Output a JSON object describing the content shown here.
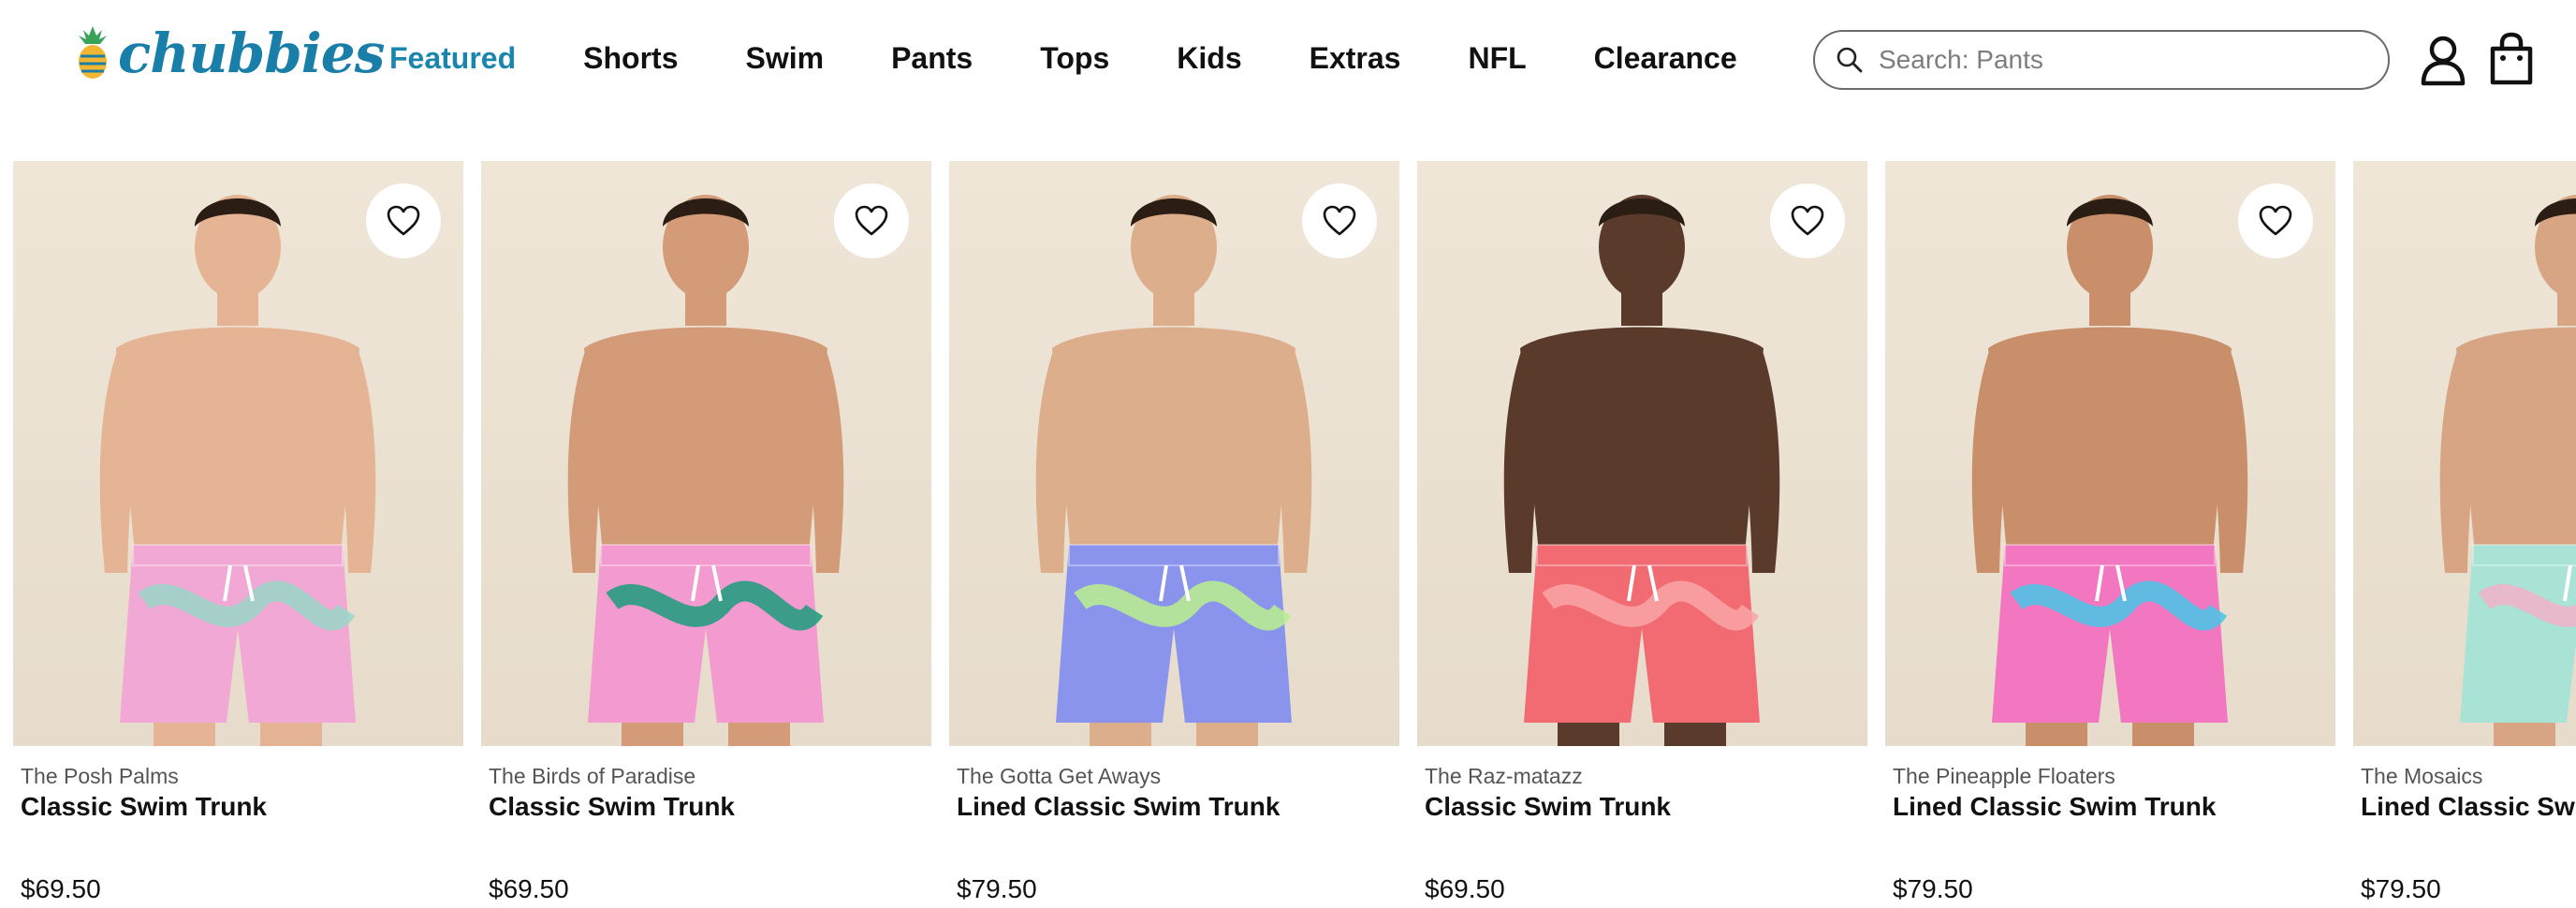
{
  "brand": {
    "name": "chubbies",
    "logo_icon": "pineapple-icon",
    "color": "#1a7fa8"
  },
  "nav": {
    "items": [
      {
        "label": "Featured",
        "active": true
      },
      {
        "label": "Shorts"
      },
      {
        "label": "Swim"
      },
      {
        "label": "Pants"
      },
      {
        "label": "Tops"
      },
      {
        "label": "Kids"
      },
      {
        "label": "Extras"
      },
      {
        "label": "NFL"
      },
      {
        "label": "Clearance"
      }
    ],
    "active_color": "#1a86ad"
  },
  "search": {
    "placeholder": "Search: Pants",
    "value": "",
    "icon": "search-icon"
  },
  "header_icons": {
    "account": "user-icon",
    "cart": "shopping-bag-icon"
  },
  "products": [
    {
      "name": "The Posh Palms",
      "title": "Classic Swim Trunk",
      "price": "$69.50",
      "wishlist_icon": "heart-icon",
      "skin": "#e4b494",
      "shorts": "#f2a8d4",
      "accent": "#9ad6c8"
    },
    {
      "name": "The Birds of Paradise",
      "title": "Classic Swim Trunk",
      "price": "$69.50",
      "wishlist_icon": "heart-icon",
      "skin": "#d39b78",
      "shorts": "#f39bd0",
      "accent": "#1a9c7c"
    },
    {
      "name": "The Gotta Get Aways",
      "title": "Lined Classic Swim Trunk",
      "price": "$79.50",
      "wishlist_icon": "heart-icon",
      "skin": "#dcae8c",
      "shorts": "#8a94ec",
      "accent": "#b9f08e"
    },
    {
      "name": "The Raz-matazz",
      "title": "Classic Swim Trunk",
      "price": "$69.50",
      "wishlist_icon": "heart-icon",
      "skin": "#5a3a2a",
      "shorts": "#f26b73",
      "accent": "#f9a5a7"
    },
    {
      "name": "The Pineapple Floaters",
      "title": "Lined Classic Swim Trunk",
      "price": "$79.50",
      "wishlist_icon": "heart-icon",
      "skin": "#c98e6a",
      "shorts": "#f377c0",
      "accent": "#46c6e8"
    },
    {
      "name": "The Mosaics",
      "title": "Lined Classic Swim Trunk",
      "price": "$79.50",
      "wishlist_icon": "heart-icon",
      "skin": "#d7a584",
      "shorts": "#a8e3d6",
      "accent": "#f3b2c8"
    }
  ]
}
